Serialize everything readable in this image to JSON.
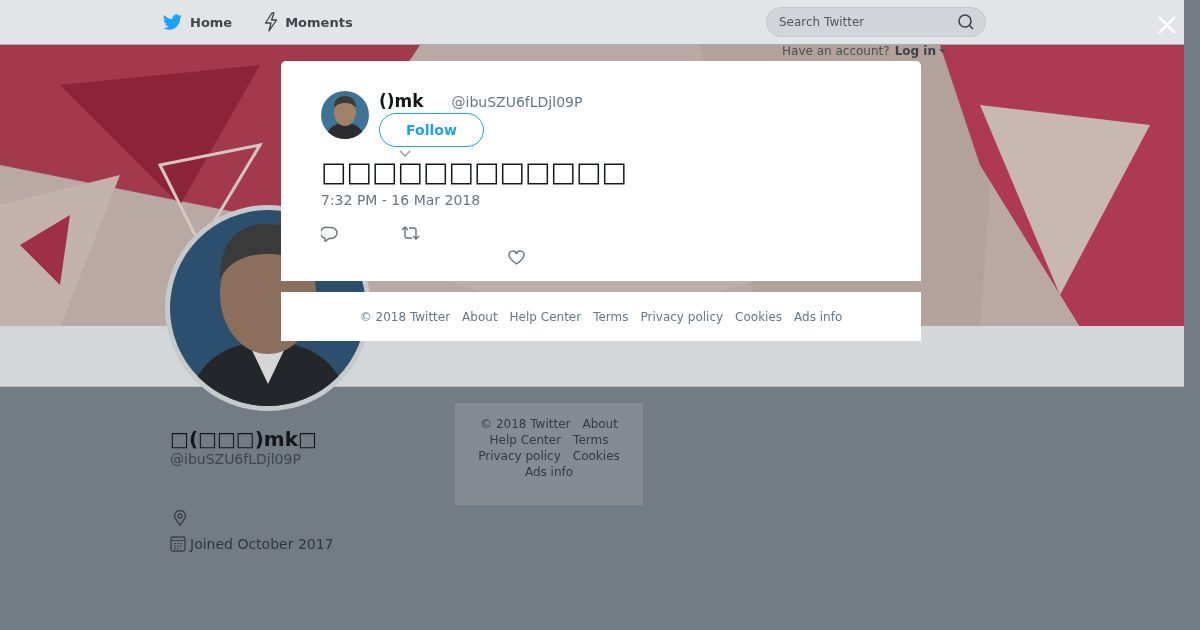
{
  "header": {
    "nav": [
      {
        "label": "Home"
      },
      {
        "label": "Moments"
      }
    ],
    "search": {
      "placeholder": "Search Twitter"
    },
    "login_prompt": "Have an account?",
    "login_link": "Log in"
  },
  "profile": {
    "display_name": "□(□□□)mk□",
    "handle": "@ibuSZU6fLDjl09P",
    "joined": "Joined October 2017"
  },
  "sidebar_footer": [
    "© 2018 Twitter",
    "About",
    "Help Center",
    "Terms",
    "Privacy policy",
    "Cookies",
    "Ads info"
  ],
  "tweet": {
    "name": "()mk",
    "handle": "@ibuSZU6fLDjl09P",
    "follow": "Follow",
    "text": "□□□□□□□□□□□□",
    "time": "7:32 PM - 16 Mar 2018"
  },
  "modal_footer": [
    "© 2018 Twitter",
    "About",
    "Help Center",
    "Terms",
    "Privacy policy",
    "Cookies",
    "Ads info"
  ]
}
